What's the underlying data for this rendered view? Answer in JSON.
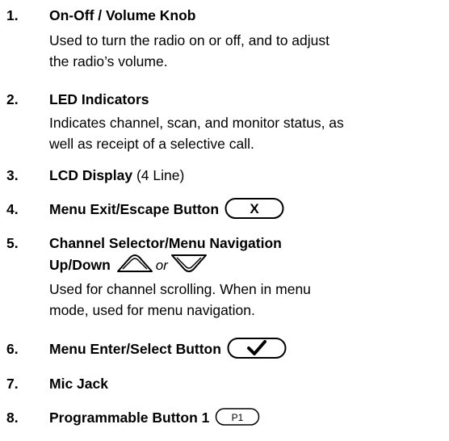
{
  "items": [
    {
      "number": "1.",
      "title": "On-Off / Volume Knob",
      "desc_lines": [
        "Used to turn the radio on or off, and to adjust",
        "the radio’s volume."
      ]
    },
    {
      "number": "2.",
      "title": "LED Indicators",
      "desc_lines": [
        "Indicates channel, scan, and monitor status, as",
        "well as receipt of a selective call."
      ]
    },
    {
      "number": "3.",
      "title": "LCD Display",
      "title_suffix": " (4 Line)"
    },
    {
      "number": "4.",
      "title": "Menu Exit/Escape Button",
      "button_label": "X"
    },
    {
      "number": "5.",
      "title": "Channel Selector/Menu Navigation",
      "title_line2": "Up/Down",
      "or_text": "or",
      "desc_lines": [
        "Used for channel scrolling. When in menu",
        "mode, used for menu navigation."
      ]
    },
    {
      "number": "6.",
      "title": "Menu Enter/Select Button",
      "button_label": "✓"
    },
    {
      "number": "7.",
      "title": "Mic Jack"
    },
    {
      "number": "8.",
      "title": "Programmable Button 1",
      "button_label": "P1"
    }
  ],
  "icons": {
    "menu_exit": "x-button-icon",
    "nav_up": "up-arrow-button-icon",
    "nav_down": "down-arrow-button-icon",
    "menu_enter": "checkmark-button-icon",
    "programmable": "p1-button-icon"
  }
}
